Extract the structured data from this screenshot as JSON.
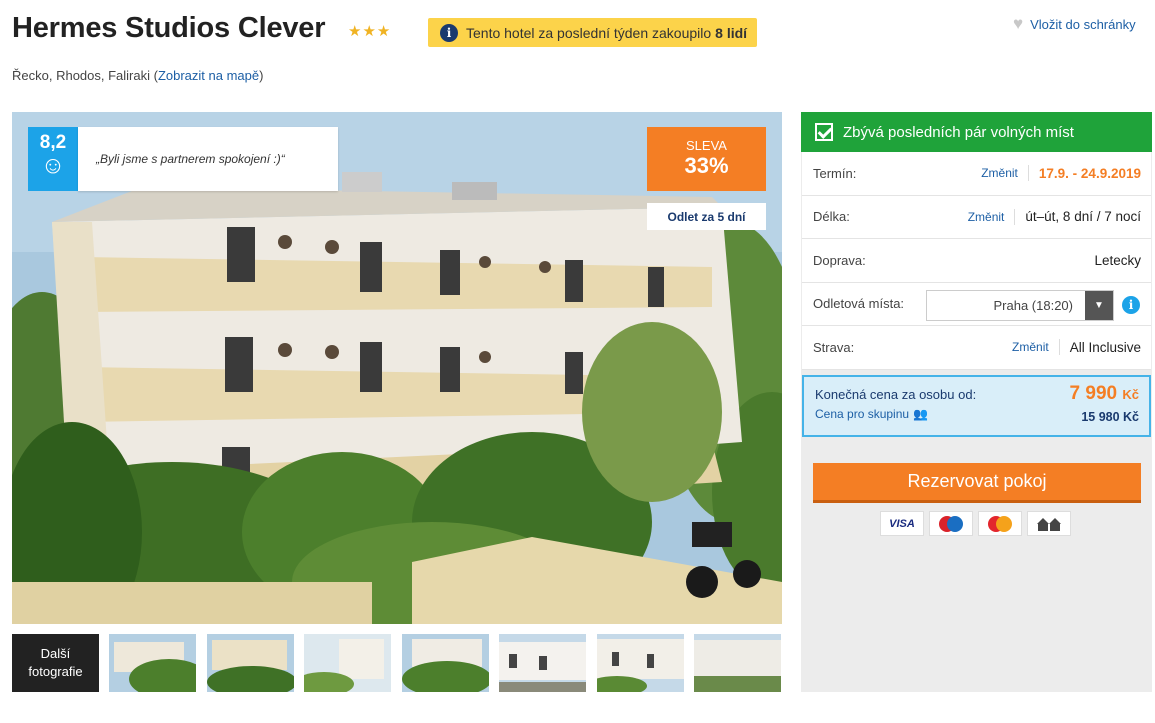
{
  "hotel": {
    "name": "Hermes Studios Clever",
    "stars": "★★★",
    "location_prefix": "Řecko, Rhodos, Faliraki (",
    "map_link": "Zobrazit na mapě",
    "location_suffix": ")"
  },
  "promo": {
    "text": "Tento hotel za poslední týden zakoupilo",
    "count": "8 lidí",
    "icon": "info-icon"
  },
  "wishlist": {
    "label": "Vložit do schránky",
    "icon": "heart-icon"
  },
  "gallery": {
    "rating": "8,2",
    "rating_icon": "smiley-icon",
    "quote": "„Byli jsme s partnerem spokojení :)“",
    "sale_label": "SLEVA",
    "sale_value": "33%",
    "departure": "Odlet za 5 dní",
    "more_photos_line1": "Další",
    "more_photos_line2": "fotografie"
  },
  "booking": {
    "availability": "Zbývá posledních pár volných míst",
    "rows": [
      {
        "label": "Termín:",
        "change": "Změnit",
        "value": "17.9. - 24.9.2019"
      },
      {
        "label": "Délka:",
        "change": "Změnit",
        "value": "út–út, 8 dní / 7 nocí"
      },
      {
        "label": "Doprava:",
        "value": "Letecky"
      },
      {
        "label": "Odletová místa:",
        "value": "Praha (18:20)"
      },
      {
        "label": "Strava:",
        "change": "Změnit",
        "value": "All Inclusive"
      }
    ],
    "price_label": "Konečná cena za osobu od:",
    "price_value": "7 990",
    "price_currency": "Kč",
    "group_label": "Cena pro skupinu",
    "group_price": "15 980 Kč",
    "book_button": "Rezervovat pokoj",
    "payment_cards": [
      "VISA",
      "Maestro",
      "MasterCard",
      "bank"
    ]
  },
  "colors": {
    "accent": "#f47e24",
    "link": "#1d5fa5",
    "success": "#1fa33a",
    "rating": "#1ca3e8",
    "promo": "#fcd34a"
  }
}
